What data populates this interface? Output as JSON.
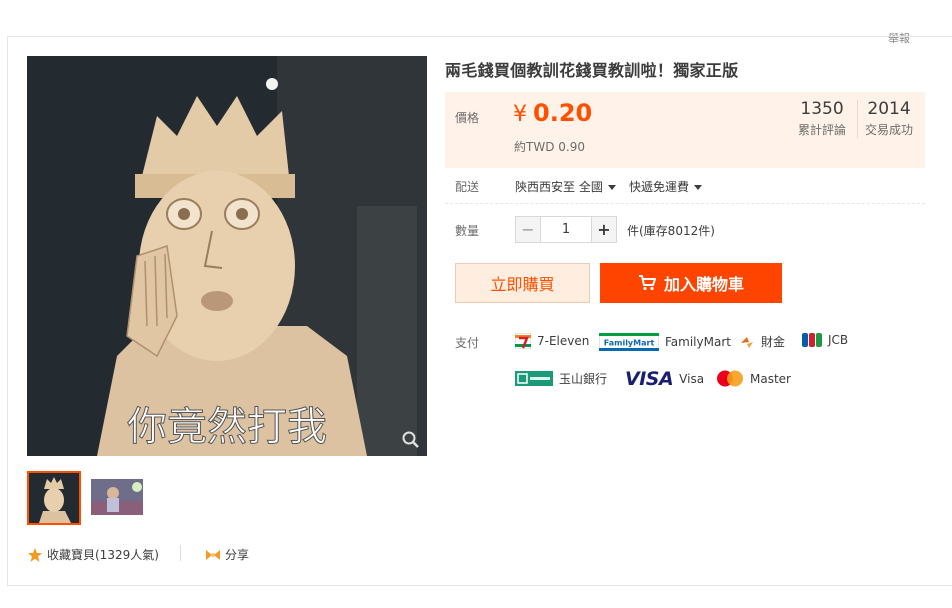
{
  "header": {
    "report_label": "舉報"
  },
  "product": {
    "title": "兩毛錢買個教訓花錢買教訓啦！獨家正版",
    "image_caption": "你竟然打我"
  },
  "price": {
    "label": "價格",
    "currency": "¥",
    "value": "0.20",
    "twd": "約TWD 0.90"
  },
  "stats": {
    "reviews_count": "1350",
    "reviews_label": "累計評論",
    "sales_count": "2014",
    "sales_label": "交易成功"
  },
  "shipping": {
    "label": "配送",
    "from": "陝西西安至 全國",
    "method": "快遞免運費"
  },
  "quantity": {
    "label": "數量",
    "value": "1",
    "stock": "件(庫存8012件)"
  },
  "actions": {
    "buy_now": "立即購買",
    "add_to_cart": "加入購物車"
  },
  "payment": {
    "label": "支付",
    "methods": [
      "7-Eleven",
      "FamilyMart",
      "財金",
      "JCB",
      "玉山銀行",
      "Visa",
      "Master"
    ],
    "visa_logo": "VISA",
    "familymart_logo": "FamilyMart"
  },
  "footer": {
    "favorite": "收藏寶貝(1329人氣)",
    "share": "分享"
  },
  "colors": {
    "accent": "#ff5000",
    "price_bg": "#fff2e8"
  }
}
